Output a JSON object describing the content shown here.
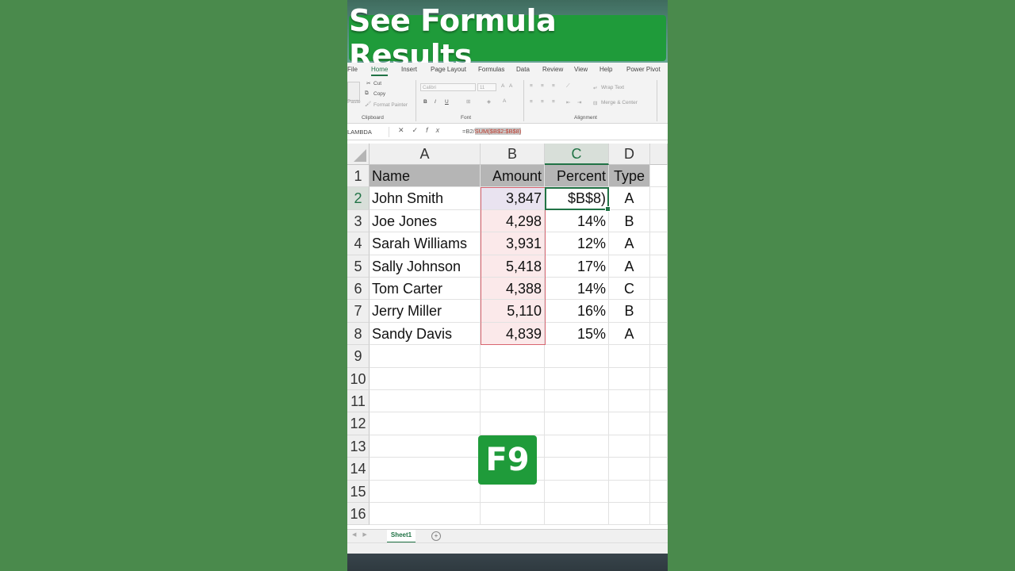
{
  "banner": {
    "title": "See Formula Results"
  },
  "ribbon": {
    "tabs": [
      "File",
      "Home",
      "Insert",
      "Page Layout",
      "Formulas",
      "Data",
      "Review",
      "View",
      "Help",
      "Power Pivot"
    ],
    "clipboard": {
      "paste": "Paste",
      "cut": "Cut",
      "copy": "Copy",
      "format_painter": "Format Painter",
      "label": "Clipboard"
    },
    "font": {
      "name": "Calibri",
      "size": "11",
      "label": "Font",
      "bold": "B",
      "italic": "I",
      "underline": "U"
    },
    "alignment": {
      "wrap_text": "Wrap Text",
      "merge_center": "Merge & Center",
      "label": "Alignment"
    }
  },
  "formula_bar": {
    "name_box": "LAMBDA",
    "formula_prefix": "=B2/",
    "formula_highlight": "SUM($B$2:$B$8)"
  },
  "columns": [
    "A",
    "B",
    "C",
    "D"
  ],
  "rows": [
    "1",
    "2",
    "3",
    "4",
    "5",
    "6",
    "7",
    "8",
    "9",
    "10",
    "11",
    "12",
    "13",
    "14",
    "15",
    "16"
  ],
  "table": {
    "headers": [
      "Name",
      "Amount",
      "Percent",
      "Type"
    ],
    "data": [
      [
        "John Smith",
        "3,847",
        "$B$8)",
        "A"
      ],
      [
        "Joe Jones",
        "4,298",
        "14%",
        "B"
      ],
      [
        "Sarah Williams",
        "3,931",
        "12%",
        "A"
      ],
      [
        "Sally  Johnson",
        "5,418",
        "17%",
        "A"
      ],
      [
        "Tom Carter",
        "4,388",
        "14%",
        "C"
      ],
      [
        "Jerry Miller",
        "5,110",
        "16%",
        "B"
      ],
      [
        "Sandy Davis",
        "4,839",
        "15%",
        "A"
      ]
    ]
  },
  "overlay": {
    "key_label": "F9"
  },
  "sheet_tabs": [
    "Sheet1"
  ],
  "colors": {
    "excel_green": "#217346",
    "banner_green": "#1f9b3a",
    "background": "#4a8a4c"
  }
}
